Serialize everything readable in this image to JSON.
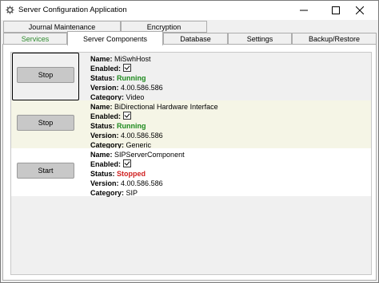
{
  "window": {
    "title": "Server Configuration Application",
    "icons": {
      "app": "gear-icon",
      "minimize": "minimize-icon",
      "maximize": "maximize-icon",
      "close": "close-icon"
    }
  },
  "tabs": {
    "row_back": [
      "Journal Maintenance",
      "Encryption"
    ],
    "row_front": [
      "Services",
      "Server Components",
      "Database",
      "Settings",
      "Backup/Restore"
    ],
    "active": "Server Components",
    "accent_color": "#2e8b2e"
  },
  "labels": {
    "name": "Name:",
    "enabled": "Enabled:",
    "status": "Status:",
    "version": "Version:",
    "category": "Category:"
  },
  "components": [
    {
      "button": "Stop",
      "name": "MiSwhHost",
      "enabled": true,
      "status": "Running",
      "version": "4.00.586.586",
      "category": "Video"
    },
    {
      "button": "Stop",
      "name": "BiDirectional Hardware Interface",
      "enabled": true,
      "status": "Running",
      "version": "4.00.586.586",
      "category": "Generic"
    },
    {
      "button": "Start",
      "name": "SIPServerComponent",
      "enabled": true,
      "status": "Stopped",
      "version": "4.00.586.586",
      "category": "SIP"
    }
  ],
  "status_colors": {
    "Running": "#1e8a1e",
    "Stopped": "#d02020"
  }
}
